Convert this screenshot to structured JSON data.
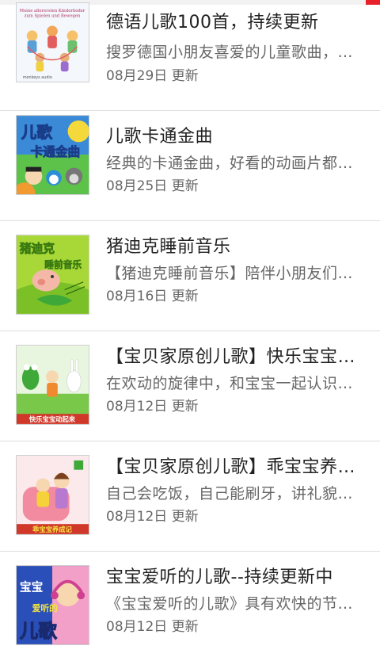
{
  "status_bar": {
    "accent_color": "#e8202a"
  },
  "items": [
    {
      "title": "德语儿歌100首，持续更新",
      "description": "搜罗德国小朋友喜爱的儿童歌曲，让宝宝在快乐中学习",
      "date": "08月29日 更新",
      "cover": {
        "line1": "Meine allerersten Kinderlieder",
        "line2": "zum Spielen und Bewegen",
        "brand": "monkeys audio"
      }
    },
    {
      "title": "儿歌卡通金曲",
      "description": "经典的卡通金曲，好看的动画片都有好听的歌曲",
      "date": "08月25日 更新",
      "cover": {
        "line1": "儿歌",
        "line2": "卡通金曲"
      }
    },
    {
      "title": "猪迪克睡前音乐",
      "description": "【猪迪克睡前音乐】陪伴小朋友们进入甜美的梦乡",
      "date": "08月16日 更新",
      "cover": {
        "line1": "猪迪克",
        "line2": "睡前音乐"
      }
    },
    {
      "title": "【宝贝家原创儿歌】快乐宝宝动起来",
      "description": "在欢动的旋律中，和宝宝一起认识身体的各个部位",
      "date": "08月12日 更新",
      "cover": {
        "caption": "快乐宝宝动起来"
      }
    },
    {
      "title": "【宝贝家原创儿歌】乖宝宝养成记",
      "description": "自己会吃饭，自己能刷牙，讲礼貌的好宝宝",
      "date": "08月12日 更新",
      "cover": {
        "caption": "乖宝宝养成记"
      }
    },
    {
      "title": "宝宝爱听的儿歌--持续更新中",
      "description": "《宝宝爱听的儿歌》具有欢快的节奏和优美的旋律",
      "date": "08月12日 更新",
      "cover": {
        "line1": "宝宝",
        "line2": "爱听的",
        "line3": "儿歌"
      }
    }
  ]
}
